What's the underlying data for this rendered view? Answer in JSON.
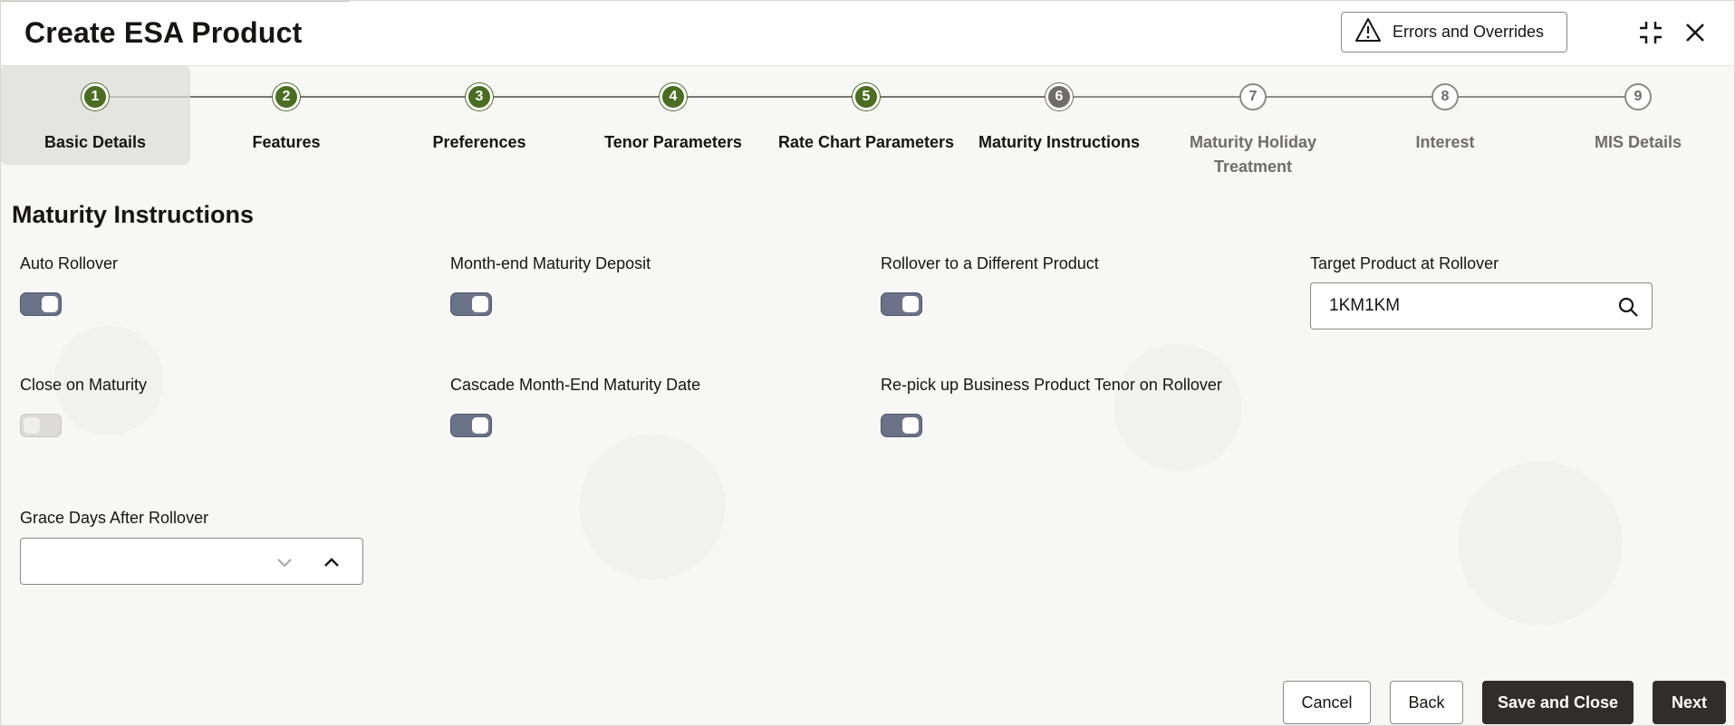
{
  "header": {
    "title": "Create ESA Product",
    "errors_button_label": "Errors and Overrides",
    "minimize_icon": "collapse-icon",
    "close_icon": "close-icon"
  },
  "stepper": {
    "steps": [
      {
        "number": "1",
        "label": "Basic Details",
        "state": "done"
      },
      {
        "number": "2",
        "label": "Features",
        "state": "done"
      },
      {
        "number": "3",
        "label": "Preferences",
        "state": "done"
      },
      {
        "number": "4",
        "label": "Tenor Parameters",
        "state": "done"
      },
      {
        "number": "5",
        "label": "Rate Chart Parameters",
        "state": "done"
      },
      {
        "number": "6",
        "label": "Maturity Instructions",
        "state": "current"
      },
      {
        "number": "7",
        "label": "Maturity Holiday Treatment",
        "state": "todo"
      },
      {
        "number": "8",
        "label": "Interest",
        "state": "todo"
      },
      {
        "number": "9",
        "label": "MIS Details",
        "state": "todo"
      }
    ]
  },
  "section": {
    "title": "Maturity Instructions",
    "fields": {
      "auto_rollover": {
        "label": "Auto Rollover",
        "on": true
      },
      "month_end_maturity_deposit": {
        "label": "Month-end Maturity Deposit",
        "on": true
      },
      "rollover_different_product": {
        "label": "Rollover to a Different Product",
        "on": true
      },
      "target_product": {
        "label": "Target Product at Rollover",
        "value": "1KM1KM"
      },
      "close_on_maturity": {
        "label": "Close on Maturity",
        "on": false
      },
      "cascade_month_end": {
        "label": "Cascade Month-End Maturity Date",
        "on": true
      },
      "repick_tenor": {
        "label": "Re-pick up Business Product Tenor on Rollover",
        "on": true
      },
      "grace_days": {
        "label": "Grace Days After Rollover",
        "value": ""
      }
    }
  },
  "footer": {
    "cancel": "Cancel",
    "back": "Back",
    "save_close": "Save and Close",
    "next": "Next"
  },
  "colors": {
    "step_done": "#4a6d22",
    "step_current": "#6f6d69",
    "toggle_on": "#6b7389",
    "primary_button": "#312d2a"
  }
}
